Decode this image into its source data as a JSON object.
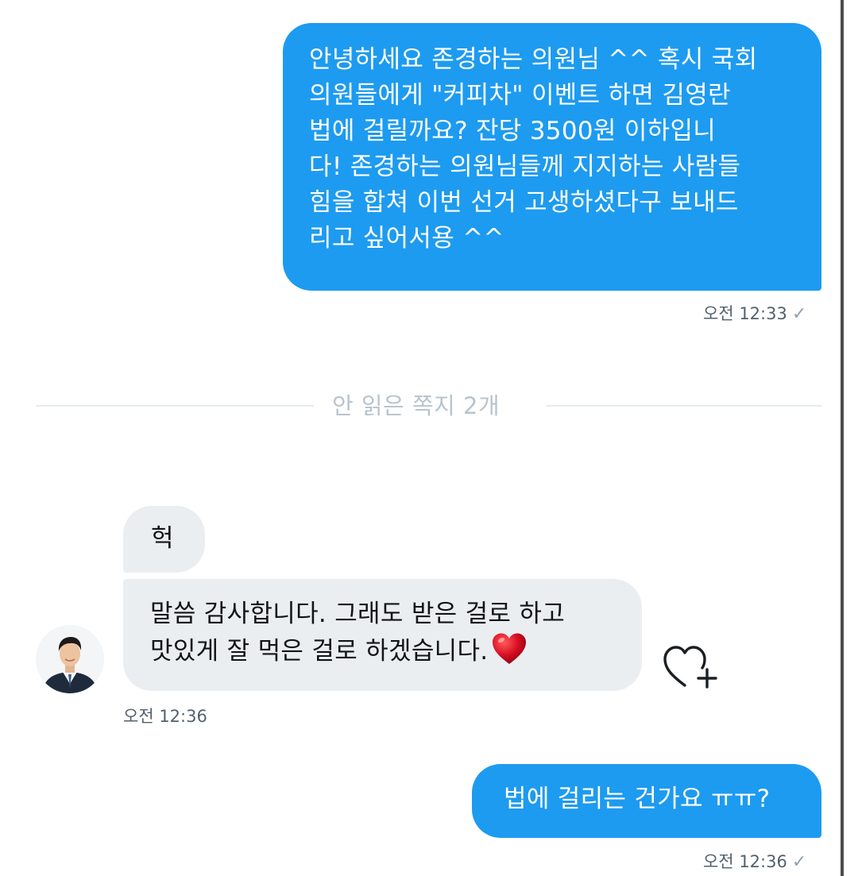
{
  "conversation": {
    "messages": [
      {
        "direction": "outgoing",
        "text": "안녕하세요 존경하는 의원님 ^^ 혹시 국회\n의원들에게 \"커피차\" 이벤트 하면 김영란\n법에 걸릴까요? 잔당 3500원 이하입니\n다! 존경하는 의원님들께 지지하는 사람들\n힘을 합쳐 이번 선거 고생하셨다구 보내드\n리고 싶어서용 ^^",
        "time": "오전 12:33",
        "status_icon": "check-icon"
      },
      {
        "direction": "incoming",
        "text": "헉"
      },
      {
        "direction": "incoming",
        "text": "말씀 감사합니다. 그래도 받은 걸로 하고\n맛있게 잘 먹은 걸로 하겠습니다.",
        "emoji": "red-heart",
        "time": "오전 12:36"
      },
      {
        "direction": "outgoing",
        "text": "법에 걸리는 건가요 ㅠㅠ?",
        "time": "오전 12:36",
        "status_icon": "check-icon"
      }
    ],
    "unread_divider": "안 읽은 쪽지 2개",
    "react_icon": "heart-plus-icon"
  },
  "colors": {
    "outgoing_bubble": "#1d9bf0",
    "incoming_bubble": "#ebeef0",
    "timestamp": "#53616d",
    "divider_text": "#b8c4ce",
    "heart": "#d90f24"
  }
}
